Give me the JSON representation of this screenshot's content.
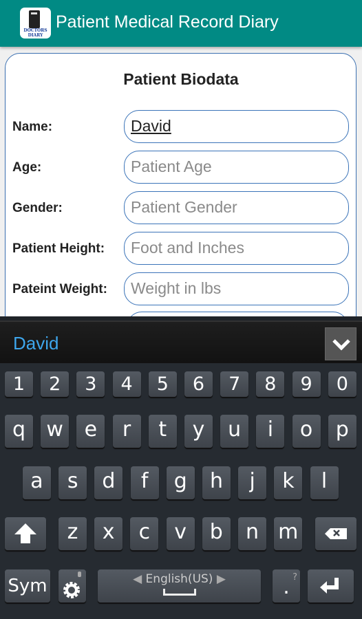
{
  "app": {
    "title": "Patient Medical Record Diary",
    "logo_text": [
      "DOCTORS",
      "DIARY"
    ],
    "accent": "#018a84"
  },
  "form": {
    "heading": "Patient Biodata",
    "fields": [
      {
        "label": "Name:",
        "value": "David",
        "placeholder": ""
      },
      {
        "label": "Age:",
        "value": "",
        "placeholder": "Patient Age"
      },
      {
        "label": "Gender:",
        "value": "",
        "placeholder": "Patient Gender"
      },
      {
        "label": "Patient Height:",
        "value": "",
        "placeholder": "Foot and Inches"
      },
      {
        "label": "Pateint Weight:",
        "value": "",
        "placeholder": "Weight in lbs"
      }
    ]
  },
  "keyboard": {
    "suggestion": "David",
    "numbers": [
      "1",
      "2",
      "3",
      "4",
      "5",
      "6",
      "7",
      "8",
      "9",
      "0"
    ],
    "row1": [
      "q",
      "w",
      "e",
      "r",
      "t",
      "y",
      "u",
      "i",
      "o",
      "p"
    ],
    "row2": [
      "a",
      "s",
      "d",
      "f",
      "g",
      "h",
      "j",
      "k",
      "l"
    ],
    "row3": [
      "z",
      "x",
      "c",
      "v",
      "b",
      "n",
      "m"
    ],
    "sym": "Sym",
    "space_label": "English(US)",
    "period": ".",
    "period_hint": "?"
  }
}
